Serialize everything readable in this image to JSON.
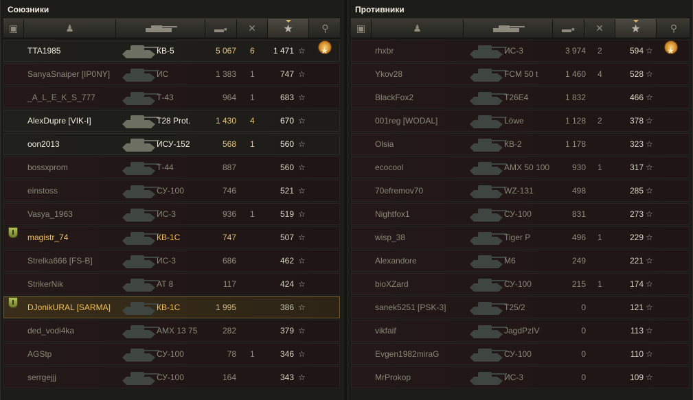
{
  "allies": {
    "title": "Союзники",
    "rows": [
      {
        "name": "TTA1985",
        "tank": "КВ-5",
        "damage": "5 067",
        "kills": "6",
        "xp": "1 471",
        "medal": true,
        "state": "alive",
        "clan_icon": false
      },
      {
        "name": "SanyaSnaiper [IP0NY]",
        "tank": "ИС",
        "damage": "1 383",
        "kills": "1",
        "xp": "747",
        "state": "dead",
        "clan_icon": false
      },
      {
        "name": "_A_L_E_K_S_777",
        "tank": "Т-43",
        "damage": "964",
        "kills": "1",
        "xp": "683",
        "state": "dead",
        "clan_icon": false
      },
      {
        "name": "AlexDupre [VIK-I]",
        "tank": "T28 Prot.",
        "damage": "1 430",
        "kills": "4",
        "xp": "670",
        "state": "alive",
        "clan_icon": false
      },
      {
        "name": "oon2013",
        "tank": "ИСУ-152",
        "damage": "568",
        "kills": "1",
        "xp": "560",
        "state": "alive",
        "clan_icon": false
      },
      {
        "name": "bossxprom",
        "tank": "Т-44",
        "damage": "887",
        "kills": "",
        "xp": "560",
        "state": "dead",
        "clan_icon": false
      },
      {
        "name": "einstoss",
        "tank": "СУ-100",
        "damage": "746",
        "kills": "",
        "xp": "521",
        "state": "dead",
        "clan_icon": false
      },
      {
        "name": "Vasya_1963",
        "tank": "ИС-3",
        "damage": "936",
        "kills": "1",
        "xp": "519",
        "state": "dead",
        "clan_icon": false
      },
      {
        "name": "magistr_74",
        "tank": "КВ-1С",
        "damage": "747",
        "kills": "",
        "xp": "507",
        "state": "dead gold",
        "clan_icon": true
      },
      {
        "name": "Strelka666 [FS-B]",
        "tank": "ИС-3",
        "damage": "686",
        "kills": "",
        "xp": "462",
        "state": "dead",
        "clan_icon": false
      },
      {
        "name": "StrikerNik",
        "tank": "AT 8",
        "damage": "117",
        "kills": "",
        "xp": "424",
        "state": "dead",
        "clan_icon": false
      },
      {
        "name": "DJonikURAL [SARMA]",
        "tank": "КВ-1С",
        "damage": "1 995",
        "kills": "",
        "xp": "386",
        "state": "highlight gold",
        "clan_icon": true
      },
      {
        "name": "ded_vodi4ka",
        "tank": "AMX 13 75",
        "damage": "282",
        "kills": "",
        "xp": "379",
        "state": "dead",
        "clan_icon": false
      },
      {
        "name": "AGStp",
        "tank": "СУ-100",
        "damage": "78",
        "kills": "1",
        "xp": "346",
        "state": "dead",
        "clan_icon": false
      },
      {
        "name": "serrgejjj",
        "tank": "СУ-100",
        "damage": "164",
        "kills": "",
        "xp": "343",
        "state": "dead",
        "clan_icon": false
      }
    ]
  },
  "enemies": {
    "title": "Противники",
    "rows": [
      {
        "name": "rhxbr",
        "tank": "ИС-3",
        "damage": "3 974",
        "kills": "2",
        "xp": "594",
        "medal": true,
        "state": "dead"
      },
      {
        "name": "Ykov28",
        "tank": "FCM 50 t",
        "damage": "1 460",
        "kills": "4",
        "xp": "528",
        "state": "dead"
      },
      {
        "name": "BlackFox2",
        "tank": "T26E4",
        "damage": "1 832",
        "kills": "",
        "xp": "466",
        "state": "dead"
      },
      {
        "name": "001reg [WODAL]",
        "tank": "Löwe",
        "damage": "1 128",
        "kills": "2",
        "xp": "378",
        "state": "dead"
      },
      {
        "name": "Olsia",
        "tank": "КВ-2",
        "damage": "1 178",
        "kills": "",
        "xp": "323",
        "state": "dead"
      },
      {
        "name": "ecocool",
        "tank": "AMX 50 100",
        "damage": "930",
        "kills": "1",
        "xp": "317",
        "state": "dead"
      },
      {
        "name": "70efremov70",
        "tank": "WZ-131",
        "damage": "498",
        "kills": "",
        "xp": "285",
        "state": "dead"
      },
      {
        "name": "Nightfox1",
        "tank": "СУ-100",
        "damage": "831",
        "kills": "",
        "xp": "273",
        "state": "dead"
      },
      {
        "name": "wisp_38",
        "tank": "Tiger P",
        "damage": "496",
        "kills": "1",
        "xp": "229",
        "state": "dead"
      },
      {
        "name": "Alexandore",
        "tank": "M6",
        "damage": "249",
        "kills": "",
        "xp": "221",
        "state": "dead"
      },
      {
        "name": "bioXZard",
        "tank": "СУ-100",
        "damage": "215",
        "kills": "1",
        "xp": "174",
        "state": "dead"
      },
      {
        "name": "sanek5251 [PSK-3]",
        "tank": "T25/2",
        "damage": "0",
        "kills": "",
        "xp": "121",
        "state": "dead"
      },
      {
        "name": "vikfaif",
        "tank": "JagdPzIV",
        "damage": "0",
        "kills": "",
        "xp": "113",
        "state": "dead"
      },
      {
        "name": "Evgen1982miraG",
        "tank": "СУ-100",
        "damage": "0",
        "kills": "",
        "xp": "110",
        "state": "dead"
      },
      {
        "name": "MrProkop",
        "tank": "ИС-3",
        "damage": "0",
        "kills": "",
        "xp": "109",
        "state": "dead"
      }
    ]
  },
  "columns": {
    "icons": [
      "clan-icon",
      "player-icon",
      "tank-icon",
      "damage-icon",
      "kills-icon",
      "xp-star-icon",
      "medal-icon"
    ],
    "sorted_column": "xp"
  },
  "glyphs": {
    "star": "☆"
  }
}
